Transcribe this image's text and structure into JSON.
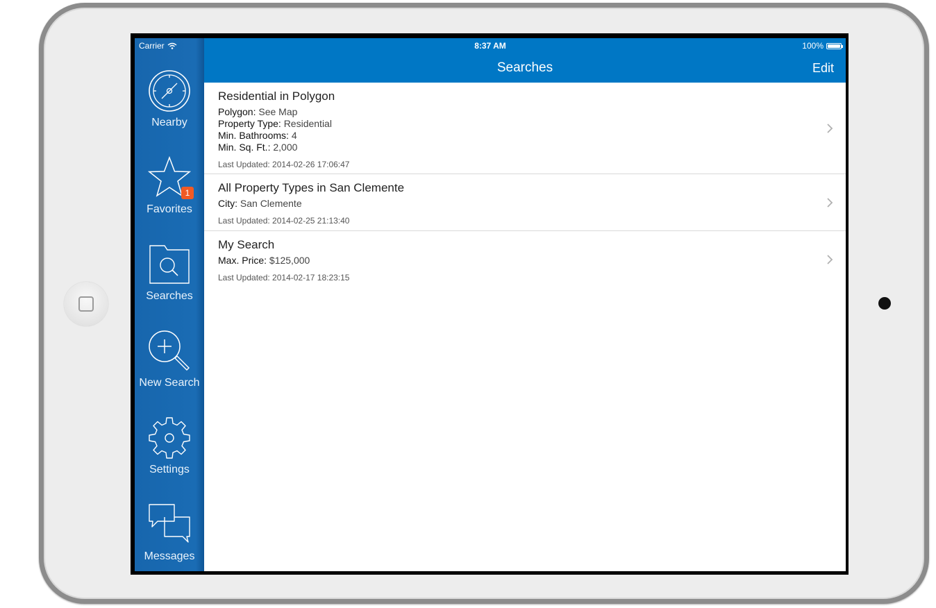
{
  "status": {
    "carrier": "Carrier",
    "time": "8:37 AM",
    "battery": "100%"
  },
  "navbar": {
    "title": "Searches",
    "edit_label": "Edit"
  },
  "sidebar": {
    "items": [
      {
        "label": "Nearby",
        "icon": "compass-icon"
      },
      {
        "label": "Favorites",
        "icon": "star-icon",
        "badge": "1"
      },
      {
        "label": "Searches",
        "icon": "folder-search-icon"
      },
      {
        "label": "New Search",
        "icon": "magnifier-plus-icon"
      },
      {
        "label": "Settings",
        "icon": "gear-icon"
      },
      {
        "label": "Messages",
        "icon": "chat-bubbles-icon"
      }
    ]
  },
  "searches": [
    {
      "title": "Residential in Polygon",
      "criteria": [
        {
          "key": "Polygon:",
          "value": "See Map"
        },
        {
          "key": "Property Type:",
          "value": "Residential"
        },
        {
          "key": "Min. Bathrooms:",
          "value": "4"
        },
        {
          "key": "Min. Sq. Ft.:",
          "value": "2,000"
        }
      ],
      "updated": "Last Updated: 2014-02-26 17:06:47"
    },
    {
      "title": "All Property Types in San Clemente",
      "criteria": [
        {
          "key": "City:",
          "value": "San Clemente"
        }
      ],
      "updated": "Last Updated: 2014-02-25 21:13:40"
    },
    {
      "title": "My Search",
      "criteria": [
        {
          "key": "Max. Price:",
          "value": "$125,000"
        }
      ],
      "updated": "Last Updated: 2014-02-17 18:23:15"
    }
  ],
  "colors": {
    "navbar": "#0077c5",
    "sidebar": "#1a6cb4",
    "badge": "#f15a24"
  }
}
